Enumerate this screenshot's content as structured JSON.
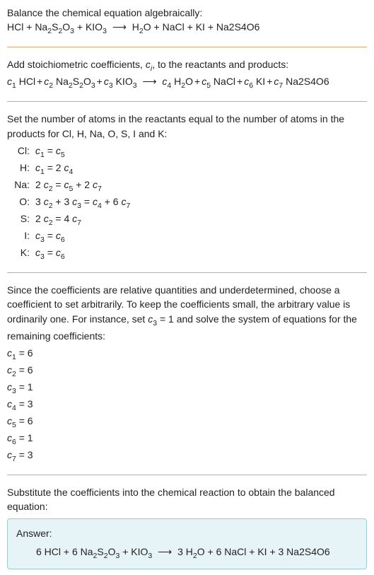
{
  "section1": {
    "intro": "Balance the chemical equation algebraically:",
    "eq": {
      "lhs1": "HCl",
      "plus": "+",
      "lhs2": "Na",
      "lhs2s": "2",
      "lhs2b": "S",
      "lhs2s2": "2",
      "lhs2c": "O",
      "lhs2s3": "3",
      "lhs3": "KIO",
      "lhs3s": "3",
      "arrow": "⟶",
      "rhs1": "H",
      "rhs1s": "2",
      "rhs1b": "O",
      "rhs2": "NaCl",
      "rhs3": "KI",
      "rhs4": "Na2S4O6"
    }
  },
  "section2": {
    "intro_a": "Add stoichiometric coefficients, ",
    "ci_c": "c",
    "ci_i": "i",
    "intro_b": ", to the reactants and products:",
    "c1": "c",
    "n1": "1",
    "t1": " HCl",
    "c2": "c",
    "n2": "2",
    "t2a": " Na",
    "t2s1": "2",
    "t2b": "S",
    "t2s2": "2",
    "t2c": "O",
    "t2s3": "3",
    "c3": "c",
    "n3": "3",
    "t3a": " KIO",
    "t3s": "3",
    "arrow": "⟶",
    "c4": "c",
    "n4": "4",
    "t4a": " H",
    "t4s": "2",
    "t4b": "O",
    "c5": "c",
    "n5": "5",
    "t5": " NaCl",
    "c6": "c",
    "n6": "6",
    "t6": " KI",
    "c7": "c",
    "n7": "7",
    "t7": " Na2S4O6",
    "plus": "+"
  },
  "section3": {
    "intro": "Set the number of atoms in the reactants equal to the number of atoms in the products for Cl, H, Na, O, S, I and K:",
    "rows": [
      {
        "label": "Cl:",
        "c1": "c",
        "s1": "1",
        "op": " = ",
        "c2": "c",
        "s2": "5"
      },
      {
        "label": "H:",
        "c1": "c",
        "s1": "1",
        "op": " = 2 ",
        "c2": "c",
        "s2": "4"
      },
      {
        "label": "Na:",
        "pre": "2 ",
        "c1": "c",
        "s1": "2",
        "op": " = ",
        "c2": "c",
        "s2": "5",
        "post": " + 2 ",
        "c3": "c",
        "s3": "7"
      },
      {
        "label": "O:",
        "pre": "3 ",
        "c1": "c",
        "s1": "2",
        "mid": " + 3 ",
        "c1b": "c",
        "s1b": "3",
        "op": " = ",
        "c2": "c",
        "s2": "4",
        "post": " + 6 ",
        "c3": "c",
        "s3": "7"
      },
      {
        "label": "S:",
        "pre": "2 ",
        "c1": "c",
        "s1": "2",
        "op": " = 4 ",
        "c2": "c",
        "s2": "7"
      },
      {
        "label": "I:",
        "c1": "c",
        "s1": "3",
        "op": " = ",
        "c2": "c",
        "s2": "6"
      },
      {
        "label": "K:",
        "c1": "c",
        "s1": "3",
        "op": " = ",
        "c2": "c",
        "s2": "6"
      }
    ]
  },
  "section4": {
    "intro_a": "Since the coefficients are relative quantities and underdetermined, choose a coefficient to set arbitrarily. To keep the coefficients small, the arbitrary value is ordinarily one. For instance, set ",
    "c3c": "c",
    "c3s": "3",
    "intro_b": " = 1 and solve the system of equations for the remaining coefficients:",
    "rows": [
      {
        "c": "c",
        "s": "1",
        "eq": " = 6"
      },
      {
        "c": "c",
        "s": "2",
        "eq": " = 6"
      },
      {
        "c": "c",
        "s": "3",
        "eq": " = 1"
      },
      {
        "c": "c",
        "s": "4",
        "eq": " = 3"
      },
      {
        "c": "c",
        "s": "5",
        "eq": " = 6"
      },
      {
        "c": "c",
        "s": "6",
        "eq": " = 1"
      },
      {
        "c": "c",
        "s": "7",
        "eq": " = 3"
      }
    ]
  },
  "section5": {
    "intro": "Substitute the coefficients into the chemical reaction to obtain the balanced equation:",
    "answer_label": "Answer:",
    "eq": {
      "p1": "6 HCl + 6 Na",
      "s1": "2",
      "p2": "S",
      "s2": "2",
      "p3": "O",
      "s3": "3",
      "p4": " + KIO",
      "s4": "3",
      "arrow": " ⟶ ",
      "p5": "3 H",
      "s5": "2",
      "p6": "O + 6 NaCl + KI + 3 Na2S4O6"
    }
  }
}
